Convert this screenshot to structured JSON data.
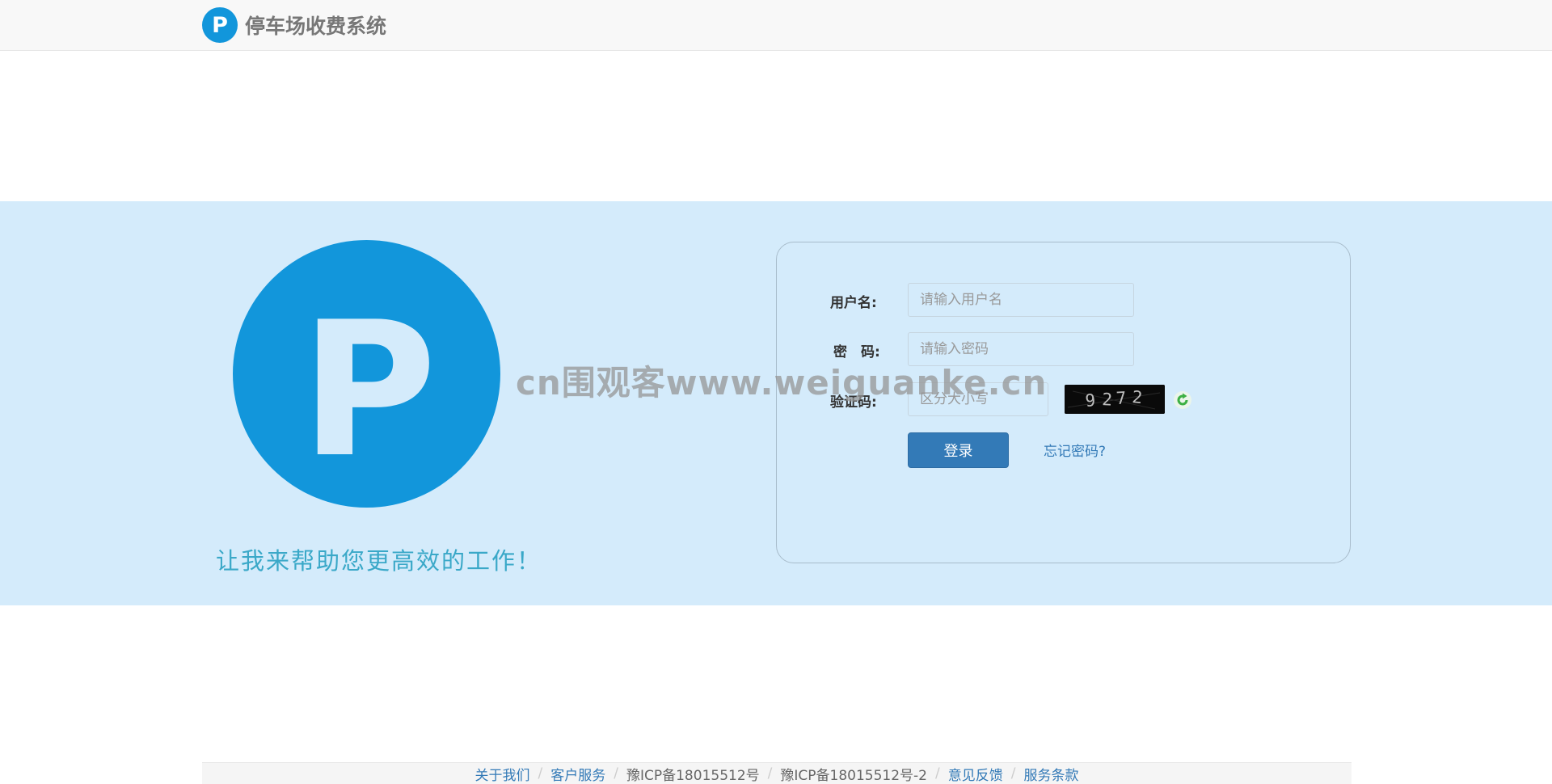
{
  "header": {
    "logo_letter": "P",
    "title": "停车场收费系统"
  },
  "hero": {
    "logo_letter": "P",
    "slogan": "让我来帮助您更高效的工作！"
  },
  "login": {
    "username_label": "用户名:",
    "username_placeholder": "请输入用户名",
    "password_label": "密　码:",
    "password_placeholder": "请输入密码",
    "captcha_label": "验证码:",
    "captcha_placeholder": "区分大小写",
    "captcha_code": "9272",
    "submit_label": "登录",
    "forgot_label": "忘记密码?"
  },
  "watermark": "cn围观客www.weiguanke.cn",
  "footer": {
    "links": [
      {
        "label": "关于我们",
        "type": "link"
      },
      {
        "label": "客户服务",
        "type": "link"
      },
      {
        "label": "豫ICP备18015512号",
        "type": "text"
      },
      {
        "label": "豫ICP备18015512号-2",
        "type": "text"
      },
      {
        "label": "意见反馈",
        "type": "link"
      },
      {
        "label": "服务条款",
        "type": "link"
      }
    ],
    "separator": "/"
  },
  "colors": {
    "brand_blue": "#1296db",
    "hero_bg": "#d4ebfb",
    "button_blue": "#337ab7",
    "slogan": "#3aa8c8",
    "refresh_green": "#3cb043"
  }
}
